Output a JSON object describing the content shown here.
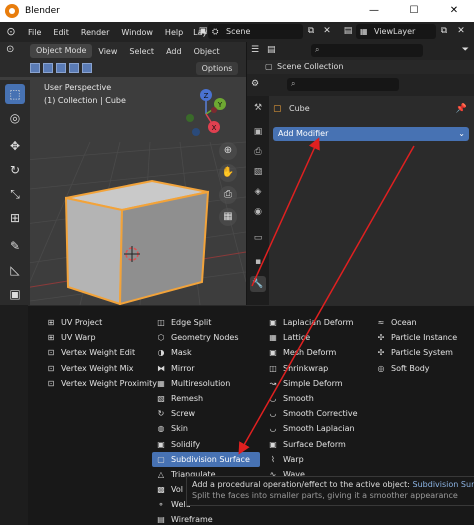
{
  "window": {
    "title": "Blender",
    "minimize": "—",
    "maximize": "☐",
    "close": "✕"
  },
  "menubar": {
    "items": [
      "File",
      "Edit",
      "Render",
      "Window",
      "Help"
    ],
    "layout_tab": "Lay",
    "scene": "Scene",
    "view_layer": "ViewLayer"
  },
  "viewport": {
    "mode": "Object Mode",
    "menus": [
      "View",
      "Select",
      "Add",
      "Object"
    ],
    "options": "Options",
    "info_view": "User Perspective",
    "info_collection": "(1) Collection | Cube",
    "gizmo_labels": {
      "z": "Z",
      "y": "Y",
      "x": "X"
    }
  },
  "properties": {
    "scene_collection": "Scene Collection",
    "object_name": "Cube",
    "add_modifier": "Add Modifier",
    "chevron": "⌄"
  },
  "menu": {
    "columns": [
      [
        "UV Project",
        "UV Warp",
        "Vertex Weight Edit",
        "Vertex Weight Mix",
        "Vertex Weight Proximity"
      ],
      [
        "Edge Split",
        "Geometry Nodes",
        "Mask",
        "Mirror",
        "Multiresolution",
        "Remesh",
        "Screw",
        "Skin",
        "Solidify",
        "Subdivision Surface",
        "Triangulate",
        "Vol",
        "Weld",
        "Wireframe"
      ],
      [
        "Laplacian Deform",
        "Lattice",
        "Mesh Deform",
        "Shrinkwrap",
        "Simple Deform",
        "Smooth",
        "Smooth Corrective",
        "Smooth Laplacian",
        "Surface Deform",
        "Warp",
        "Wave"
      ],
      [
        "Ocean",
        "Particle Instance",
        "Particle System",
        "Soft Body"
      ]
    ],
    "highlighted": "Subdivision Surface"
  },
  "tooltip": {
    "line1_prefix": "Add a procedural operation/effect to the active object:",
    "line1_highlight": "Subdivision Surface",
    "line2": "Split the faces into smaller parts, giving it a smoother appearance"
  },
  "colors": {
    "accent": "#4772b3",
    "arrow": "#e02020",
    "cube_outline": "#f2a33a"
  }
}
